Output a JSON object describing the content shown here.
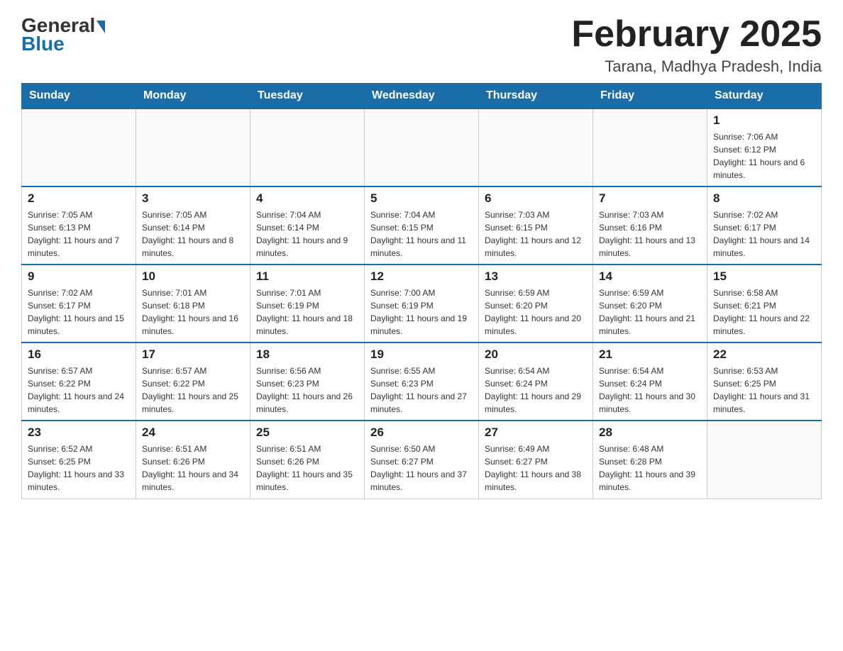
{
  "header": {
    "logo_general": "General",
    "logo_blue": "Blue",
    "title": "February 2025",
    "subtitle": "Tarana, Madhya Pradesh, India"
  },
  "days_of_week": [
    "Sunday",
    "Monday",
    "Tuesday",
    "Wednesday",
    "Thursday",
    "Friday",
    "Saturday"
  ],
  "weeks": [
    [
      {
        "day": "",
        "info": ""
      },
      {
        "day": "",
        "info": ""
      },
      {
        "day": "",
        "info": ""
      },
      {
        "day": "",
        "info": ""
      },
      {
        "day": "",
        "info": ""
      },
      {
        "day": "",
        "info": ""
      },
      {
        "day": "1",
        "info": "Sunrise: 7:06 AM\nSunset: 6:12 PM\nDaylight: 11 hours and 6 minutes."
      }
    ],
    [
      {
        "day": "2",
        "info": "Sunrise: 7:05 AM\nSunset: 6:13 PM\nDaylight: 11 hours and 7 minutes."
      },
      {
        "day": "3",
        "info": "Sunrise: 7:05 AM\nSunset: 6:14 PM\nDaylight: 11 hours and 8 minutes."
      },
      {
        "day": "4",
        "info": "Sunrise: 7:04 AM\nSunset: 6:14 PM\nDaylight: 11 hours and 9 minutes."
      },
      {
        "day": "5",
        "info": "Sunrise: 7:04 AM\nSunset: 6:15 PM\nDaylight: 11 hours and 11 minutes."
      },
      {
        "day": "6",
        "info": "Sunrise: 7:03 AM\nSunset: 6:15 PM\nDaylight: 11 hours and 12 minutes."
      },
      {
        "day": "7",
        "info": "Sunrise: 7:03 AM\nSunset: 6:16 PM\nDaylight: 11 hours and 13 minutes."
      },
      {
        "day": "8",
        "info": "Sunrise: 7:02 AM\nSunset: 6:17 PM\nDaylight: 11 hours and 14 minutes."
      }
    ],
    [
      {
        "day": "9",
        "info": "Sunrise: 7:02 AM\nSunset: 6:17 PM\nDaylight: 11 hours and 15 minutes."
      },
      {
        "day": "10",
        "info": "Sunrise: 7:01 AM\nSunset: 6:18 PM\nDaylight: 11 hours and 16 minutes."
      },
      {
        "day": "11",
        "info": "Sunrise: 7:01 AM\nSunset: 6:19 PM\nDaylight: 11 hours and 18 minutes."
      },
      {
        "day": "12",
        "info": "Sunrise: 7:00 AM\nSunset: 6:19 PM\nDaylight: 11 hours and 19 minutes."
      },
      {
        "day": "13",
        "info": "Sunrise: 6:59 AM\nSunset: 6:20 PM\nDaylight: 11 hours and 20 minutes."
      },
      {
        "day": "14",
        "info": "Sunrise: 6:59 AM\nSunset: 6:20 PM\nDaylight: 11 hours and 21 minutes."
      },
      {
        "day": "15",
        "info": "Sunrise: 6:58 AM\nSunset: 6:21 PM\nDaylight: 11 hours and 22 minutes."
      }
    ],
    [
      {
        "day": "16",
        "info": "Sunrise: 6:57 AM\nSunset: 6:22 PM\nDaylight: 11 hours and 24 minutes."
      },
      {
        "day": "17",
        "info": "Sunrise: 6:57 AM\nSunset: 6:22 PM\nDaylight: 11 hours and 25 minutes."
      },
      {
        "day": "18",
        "info": "Sunrise: 6:56 AM\nSunset: 6:23 PM\nDaylight: 11 hours and 26 minutes."
      },
      {
        "day": "19",
        "info": "Sunrise: 6:55 AM\nSunset: 6:23 PM\nDaylight: 11 hours and 27 minutes."
      },
      {
        "day": "20",
        "info": "Sunrise: 6:54 AM\nSunset: 6:24 PM\nDaylight: 11 hours and 29 minutes."
      },
      {
        "day": "21",
        "info": "Sunrise: 6:54 AM\nSunset: 6:24 PM\nDaylight: 11 hours and 30 minutes."
      },
      {
        "day": "22",
        "info": "Sunrise: 6:53 AM\nSunset: 6:25 PM\nDaylight: 11 hours and 31 minutes."
      }
    ],
    [
      {
        "day": "23",
        "info": "Sunrise: 6:52 AM\nSunset: 6:25 PM\nDaylight: 11 hours and 33 minutes."
      },
      {
        "day": "24",
        "info": "Sunrise: 6:51 AM\nSunset: 6:26 PM\nDaylight: 11 hours and 34 minutes."
      },
      {
        "day": "25",
        "info": "Sunrise: 6:51 AM\nSunset: 6:26 PM\nDaylight: 11 hours and 35 minutes."
      },
      {
        "day": "26",
        "info": "Sunrise: 6:50 AM\nSunset: 6:27 PM\nDaylight: 11 hours and 37 minutes."
      },
      {
        "day": "27",
        "info": "Sunrise: 6:49 AM\nSunset: 6:27 PM\nDaylight: 11 hours and 38 minutes."
      },
      {
        "day": "28",
        "info": "Sunrise: 6:48 AM\nSunset: 6:28 PM\nDaylight: 11 hours and 39 minutes."
      },
      {
        "day": "",
        "info": ""
      }
    ]
  ]
}
